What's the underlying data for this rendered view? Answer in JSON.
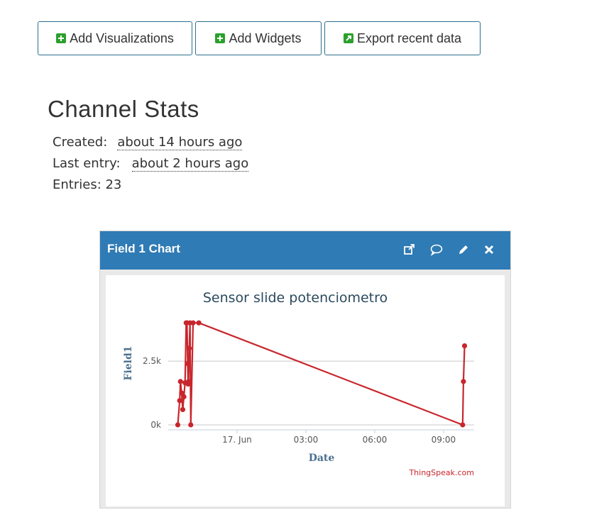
{
  "toolbar": {
    "add_visualizations": "Add Visualizations",
    "add_widgets": "Add Widgets",
    "export_recent_data": "Export recent data"
  },
  "stats": {
    "title": "Channel Stats",
    "created_label": "Created:",
    "created_value": "about 14 hours ago",
    "last_entry_label": "Last entry:",
    "last_entry_value": "about 2 hours ago",
    "entries_label": "Entries: 23"
  },
  "card": {
    "title": "Field 1 Chart",
    "icons": [
      "external-link-icon",
      "comment-icon",
      "pencil-icon",
      "close-icon"
    ]
  },
  "colors": {
    "header": "#2f7bb5",
    "series": "#c8262c",
    "button_icon": "#2ca02c"
  },
  "chart_data": {
    "type": "line",
    "title": "Sensor slide potenciometro",
    "xlabel": "Date",
    "ylabel": "Field1",
    "x_ticks": [
      "17. Jun",
      "03:00",
      "06:00",
      "09:00"
    ],
    "y_ticks": [
      "0k",
      "2.5k"
    ],
    "y_tick_values": [
      0,
      2500
    ],
    "ylim": [
      0,
      4200
    ],
    "grid": true,
    "credit": "ThingSpeak.com",
    "series": [
      {
        "x": [
          "16 Jun 21:25",
          "16 Jun 21:30",
          "16 Jun 21:32",
          "16 Jun 21:35",
          "16 Jun 21:38",
          "16 Jun 21:41",
          "16 Jun 21:44",
          "16 Jun 21:47",
          "16 Jun 21:49",
          "16 Jun 21:51",
          "16 Jun 21:52",
          "16 Jun 21:53",
          "16 Jun 21:55",
          "16 Jun 21:57",
          "16 Jun 21:59",
          "16 Jun 22:05",
          "16 Jun 22:20",
          "17 Jun 09:50",
          "17 Jun 09:52",
          "17 Jun 09:55"
        ],
        "values": [
          0,
          950,
          1700,
          1250,
          600,
          1100,
          1650,
          4000,
          4000,
          2400,
          1600,
          1700,
          3000,
          4000,
          0,
          4000,
          4000,
          0,
          1700,
          3100
        ]
      }
    ]
  }
}
